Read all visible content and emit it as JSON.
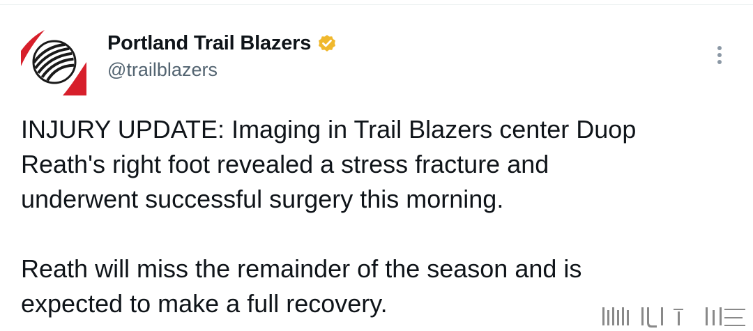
{
  "account": {
    "display_name": "Portland Trail Blazers",
    "handle": "@trailblazers",
    "verified_badge_color": "#f0b82d",
    "avatar_accent": "#d71f2b"
  },
  "tweet": {
    "paragraphs": [
      "INJURY UPDATE: Imaging in Trail Blazers center Duop\nReath's right foot revealed a stress fracture and\nunderwent successful surgery this morning.",
      "Reath will miss the remainder of the season and is\nexpected to make a full recovery."
    ]
  },
  "icons": {
    "avatar": "trail-blazers-logo",
    "verified": "verified-badge-icon",
    "more": "more-options-icon"
  }
}
